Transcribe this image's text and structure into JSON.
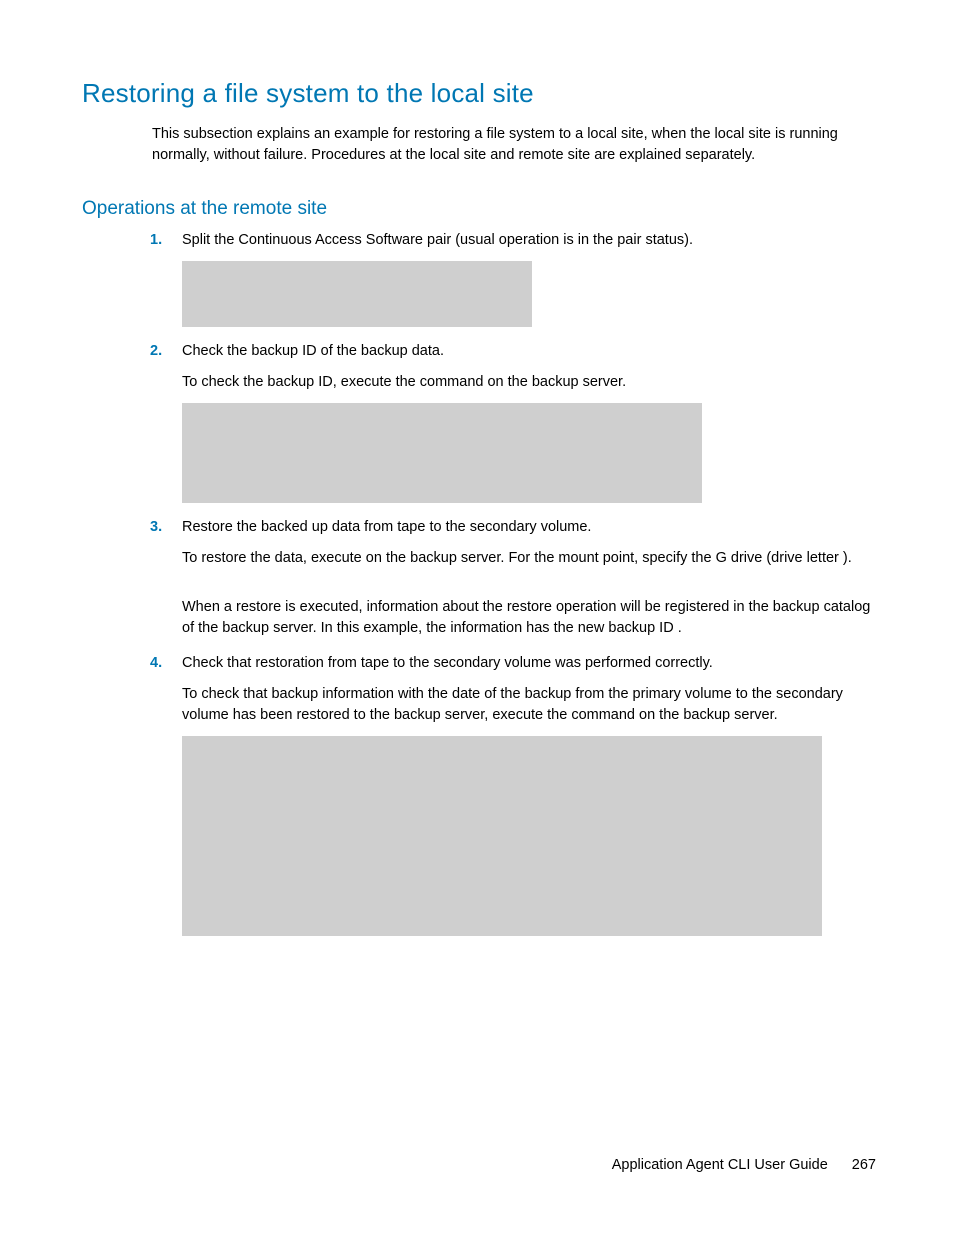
{
  "section_title": "Restoring a file system to the local site",
  "intro": "This subsection explains an example for restoring a file system to a local site, when the local site is running normally, without failure. Procedures at the local site and remote site are explained separately.",
  "subsection_title": "Operations at the remote site",
  "steps": [
    {
      "num": "1.",
      "lead": "Split the Continuous Access Software pair (usual operation is in the pair status).",
      "paras": []
    },
    {
      "num": "2.",
      "lead": "Check the backup ID of the backup data.",
      "paras": [
        {
          "segments": [
            "To check the backup ID, execute the ",
            "",
            " command on the backup server."
          ]
        }
      ]
    },
    {
      "num": "3.",
      "lead": "Restore the backed up data from tape to the secondary volume.",
      "paras": [
        {
          "segments": [
            "To restore the data, execute ",
            "",
            " on the backup server. For the mount point, specify the G drive (drive letter ",
            "",
            ")."
          ]
        },
        {
          "segments": [
            "When a restore is executed, information about the restore operation will be registered in the backup catalog of the backup server. In this example, the information has the new backup ID ",
            "",
            "."
          ]
        }
      ]
    },
    {
      "num": "4.",
      "lead": "Check that restoration from tape to the secondary volume was performed correctly.",
      "paras": [
        {
          "segments": [
            "To check that backup information with the date of the backup from the primary volume to the secondary volume has been restored to the backup server, execute the ",
            "",
            " command on the backup server."
          ]
        }
      ]
    }
  ],
  "footer_title": "Application Agent CLI User Guide",
  "page_number": "267"
}
